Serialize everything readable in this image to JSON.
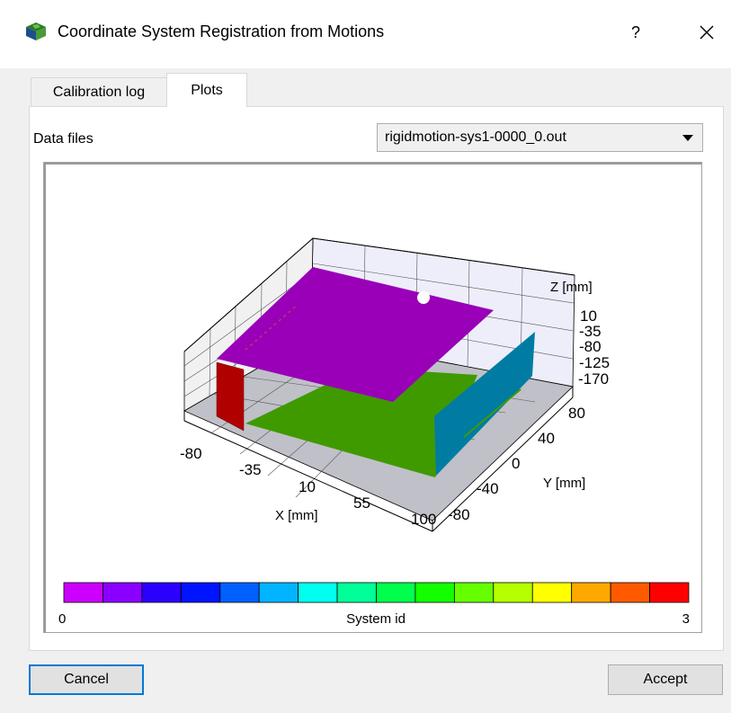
{
  "window": {
    "title": "Coordinate System Registration from Motions",
    "help_label": "?",
    "app_icon": "3d-cube-icon",
    "close_icon": "close-icon"
  },
  "tabs": [
    {
      "label": "Calibration log",
      "active": false
    },
    {
      "label": "Plots",
      "active": true
    }
  ],
  "data_files": {
    "label": "Data files",
    "selected": "rigidmotion-sys1-0000_0.out"
  },
  "plot": {
    "x_axis": {
      "label": "X [mm]",
      "ticks": [
        "-80",
        "-35",
        "10",
        "55",
        "100"
      ]
    },
    "y_axis": {
      "label": "Y [mm]",
      "ticks": [
        "80",
        "40",
        "0",
        "-40",
        "-80"
      ]
    },
    "z_axis": {
      "label": "Z [mm]",
      "ticks": [
        "10",
        "-35",
        "-80",
        "-125",
        "-170"
      ]
    },
    "surface_colors": {
      "system0": "#9900b8",
      "system1": "#3f9a00",
      "system2": "#007ca3",
      "system3": "#b00000"
    },
    "colorbar": {
      "label": "System id",
      "min": "0",
      "max": "3",
      "colors": [
        "#cc00ff",
        "#8a00ff",
        "#2c00ff",
        "#0014ff",
        "#0060ff",
        "#00b4ff",
        "#00ffee",
        "#00ff99",
        "#00ff4c",
        "#13ff00",
        "#66ff00",
        "#b6ff00",
        "#ffff00",
        "#ffa800",
        "#ff5a00",
        "#ff0000"
      ]
    }
  },
  "buttons": {
    "cancel": "Cancel",
    "accept": "Accept"
  }
}
